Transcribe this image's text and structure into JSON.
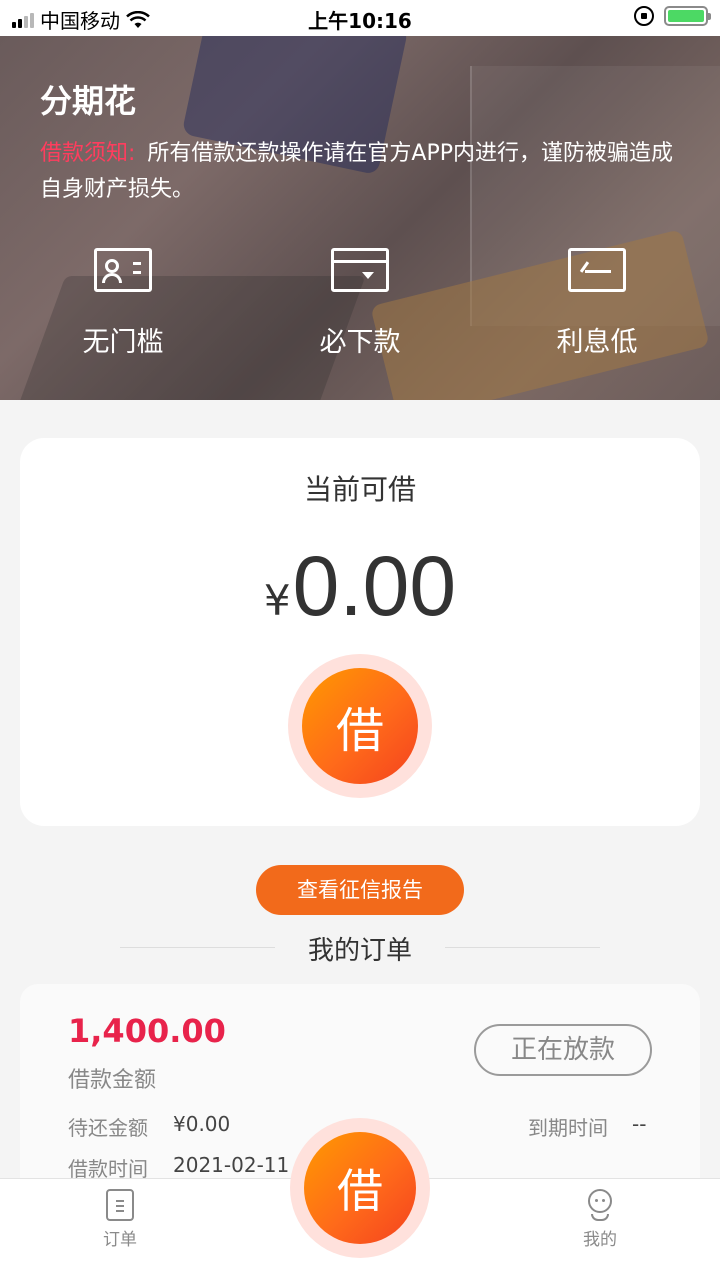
{
  "status_bar": {
    "carrier": "中国移动",
    "time": "上午10:16",
    "battery_color": "#4cd964"
  },
  "header": {
    "title": "分期花",
    "notice_label": "借款须知:",
    "notice_text": "所有借款还款操作请在官方APP内进行，谨防被骗造成自身财产损失。",
    "features": [
      {
        "label": "无门槛",
        "icon": "id-card-icon"
      },
      {
        "label": "必下款",
        "icon": "card-icon"
      },
      {
        "label": "利息低",
        "icon": "return-icon"
      }
    ]
  },
  "loan_card": {
    "caption": "当前可借",
    "currency": "¥",
    "amount": "0.00",
    "borrow_label": "借"
  },
  "credit_report_button": "查看征信报告",
  "orders": {
    "title": "我的订单",
    "items": [
      {
        "amount": "1,400.00",
        "amount_label": "借款金额",
        "status": "正在放款",
        "pending_label": "待还金额",
        "pending_value": "¥0.00",
        "due_label": "到期时间",
        "due_value": "--",
        "borrow_time_label": "借款时间",
        "borrow_time_value": "2021-02-11 0"
      }
    ]
  },
  "tabbar": {
    "left": "订单",
    "center": "借",
    "right": "我的"
  },
  "colors": {
    "accent": "#f26a1b",
    "amount_red": "#e8234b",
    "notice_red": "#ff3d5e"
  }
}
